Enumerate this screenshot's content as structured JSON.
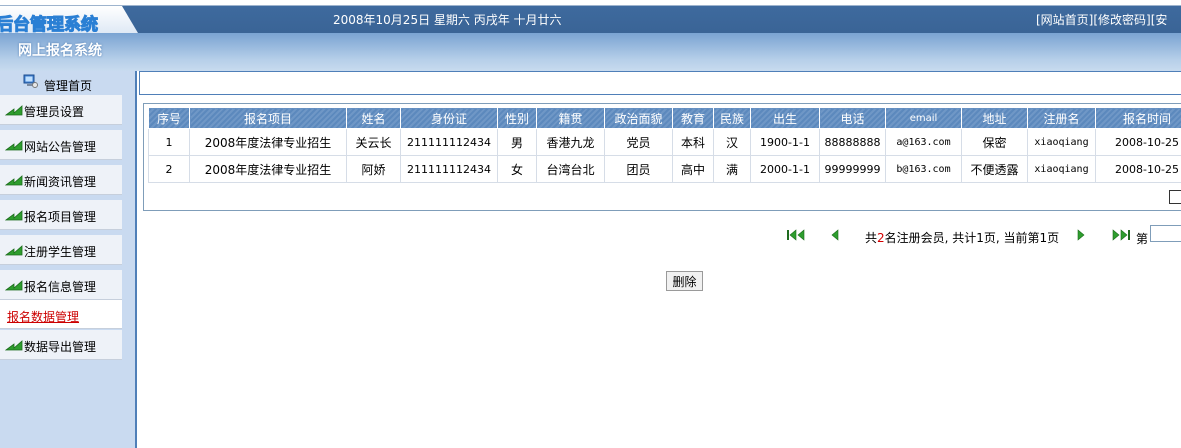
{
  "header": {
    "logo_text": "后台管理系统",
    "date": "2008年10月25日 星期六 丙戌年 十月廿六",
    "links": [
      "[网站首页]",
      "[修改密码]",
      "[安"
    ]
  },
  "subbar": {
    "title": "网上报名系统"
  },
  "sidebar": {
    "home_label": "管理首页",
    "items": [
      {
        "label": "管理员设置"
      },
      {
        "label": "网站公告管理"
      },
      {
        "label": "新闻资讯管理"
      },
      {
        "label": "报名项目管理"
      },
      {
        "label": "注册学生管理"
      },
      {
        "label": "报名信息管理"
      },
      {
        "label": "报名数据管理"
      },
      {
        "label": "数据导出管理"
      }
    ],
    "active_index": 6
  },
  "table": {
    "headers": [
      "序号",
      "报名项目",
      "姓名",
      "身份证",
      "性别",
      "籍贯",
      "政治面貌",
      "教育",
      "民族",
      "出生",
      "电话",
      "email",
      "地址",
      "注册名",
      "报名时间"
    ],
    "rows": [
      [
        "1",
        "2008年度法律专业招生",
        "关云长",
        "211111112434",
        "男",
        "香港九龙",
        "党员",
        "本科",
        "汉",
        "1900-1-1",
        "88888888",
        "a@163.com",
        "保密",
        "xiaoqiang",
        "2008-10-25"
      ],
      [
        "2",
        "2008年度法律专业招生",
        "阿娇",
        "211111112434",
        "女",
        "台湾台北",
        "团员",
        "高中",
        "满",
        "2000-1-1",
        "99999999",
        "b@163.com",
        "不便透露",
        "xiaoqiang",
        "2008-10-25"
      ]
    ]
  },
  "pager": {
    "prefix": "共",
    "count": "2",
    "suffix": "名注册会员, 共计1页, 当前第1页",
    "goto_label": "第",
    "goto_value": ""
  },
  "actions": {
    "delete_label": "删除"
  },
  "colors": {
    "header_bg": "#3a6496",
    "grid_header": "#5c89bd",
    "sidebar_bg": "#c9daf0",
    "active_text": "#cc0000"
  }
}
